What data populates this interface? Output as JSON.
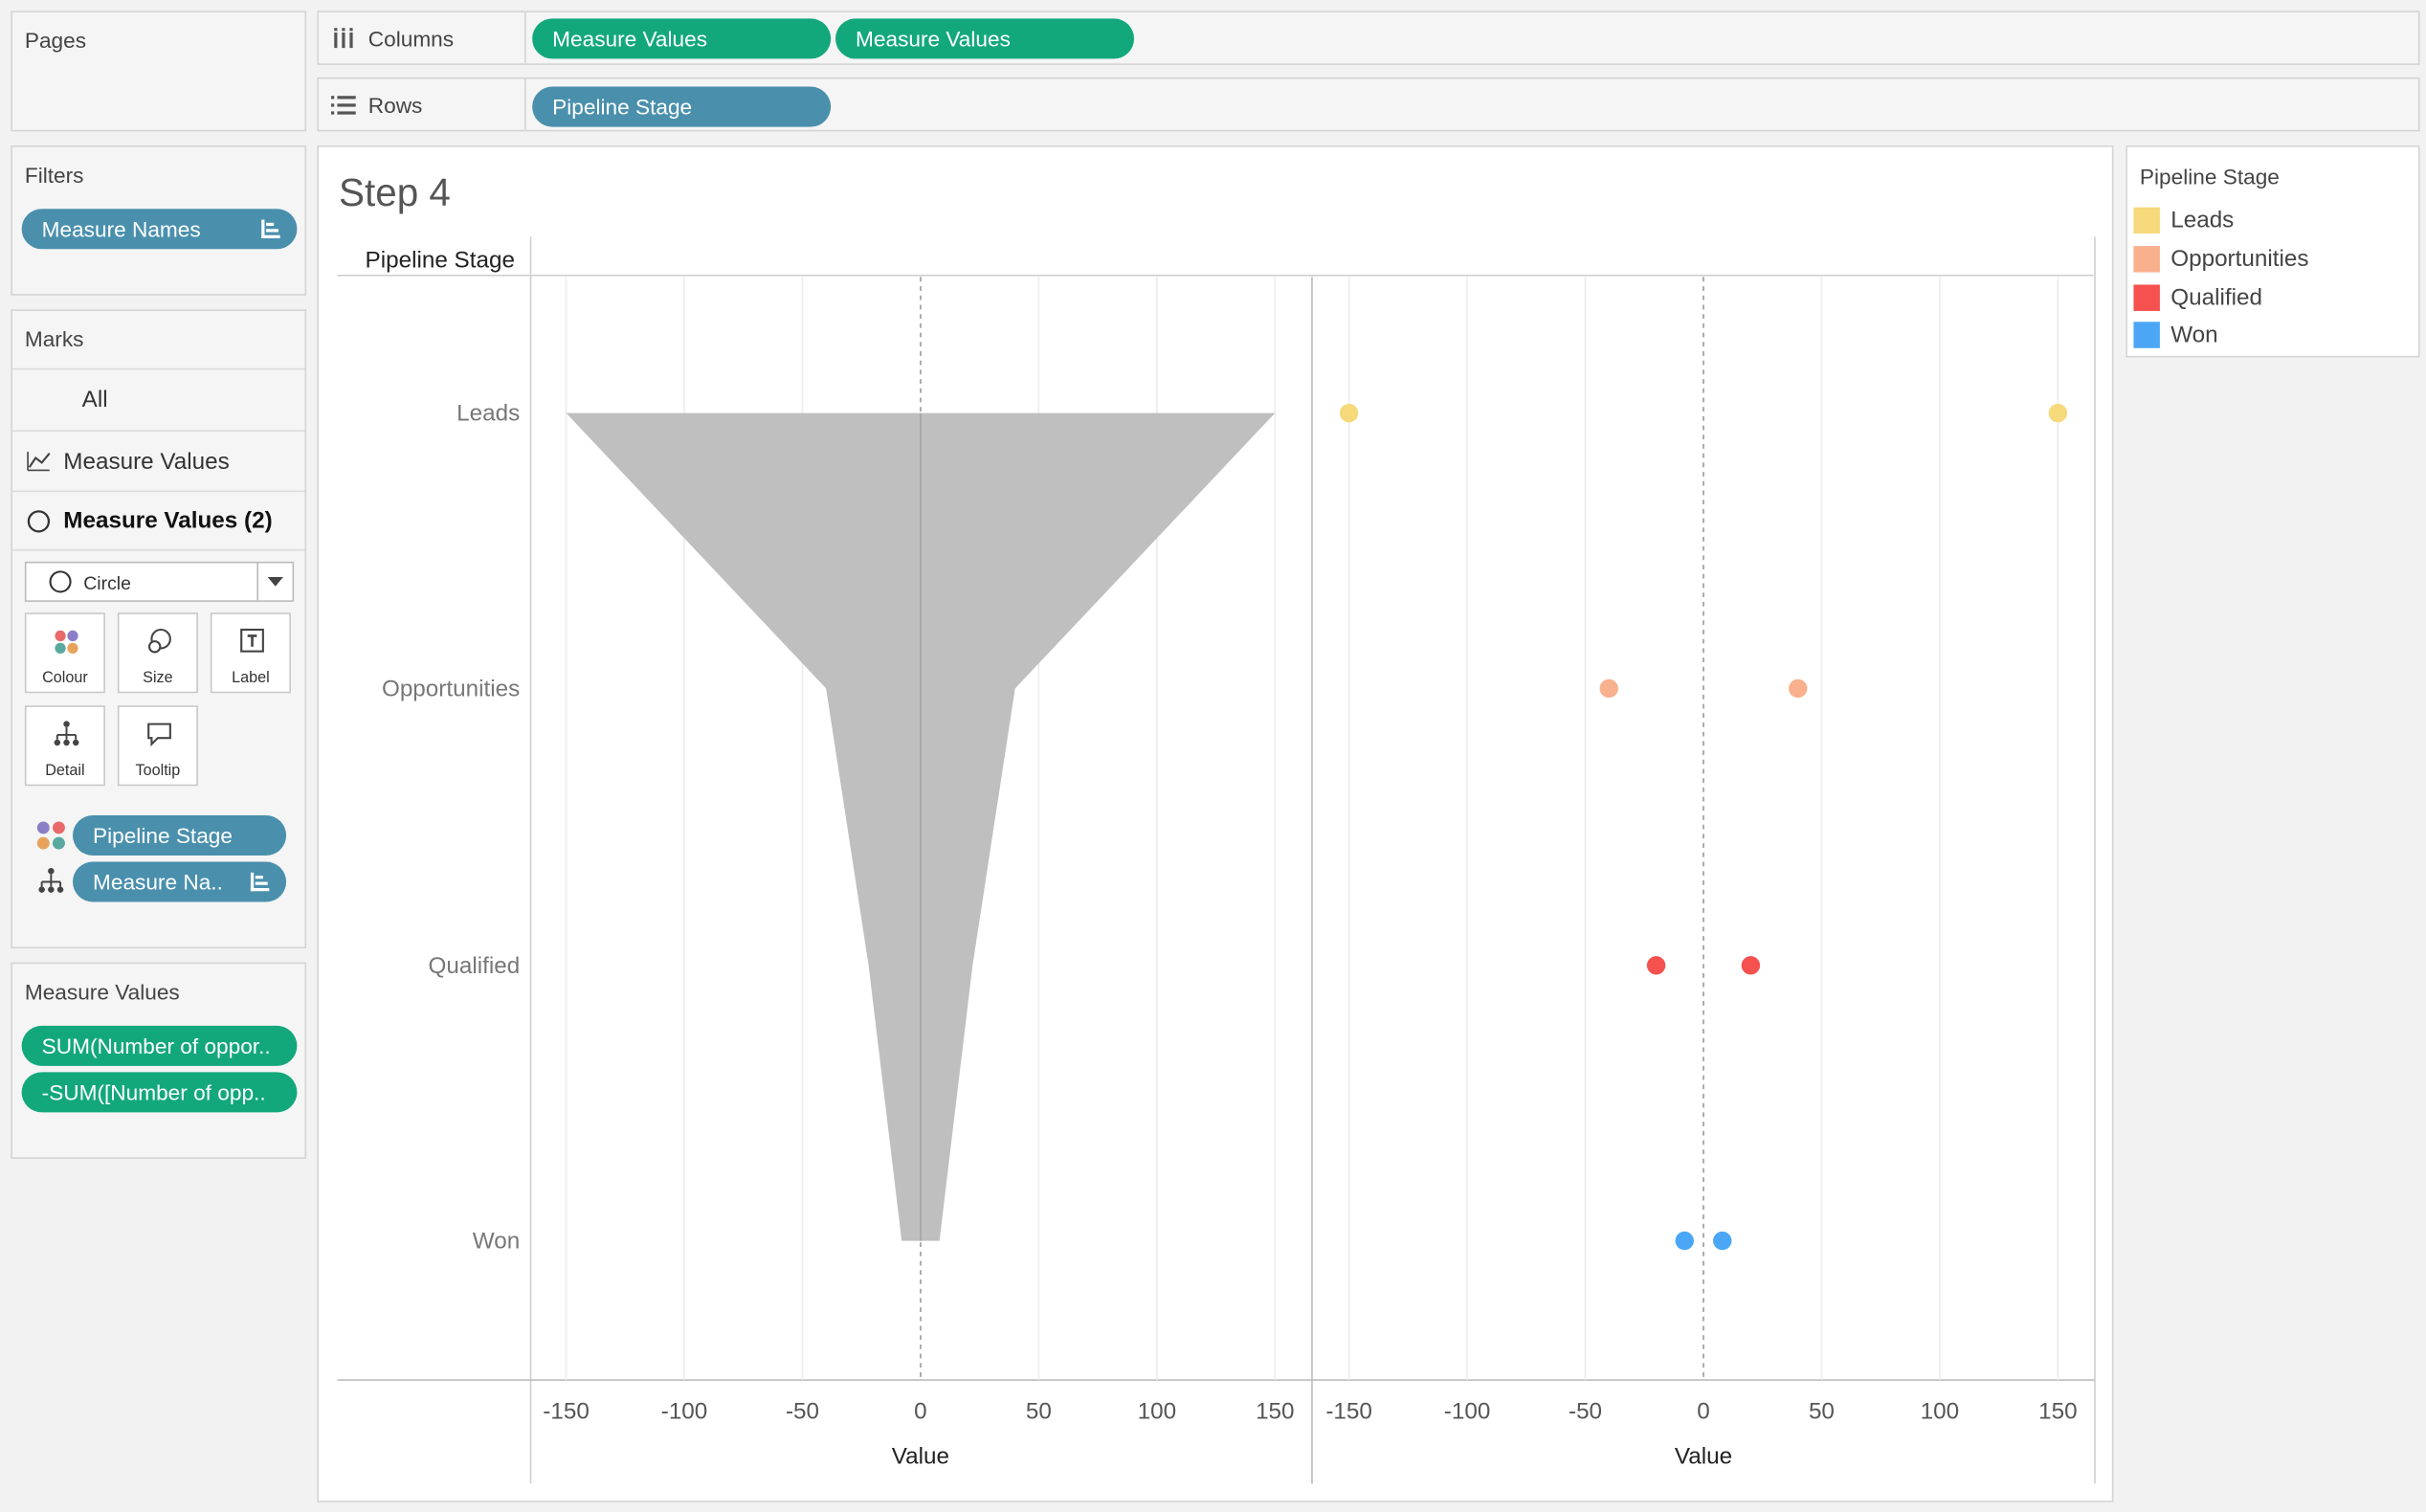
{
  "pages": {
    "title": "Pages"
  },
  "columns_shelf": {
    "label": "Columns",
    "pills": [
      "Measure Values",
      "Measure Values"
    ]
  },
  "rows_shelf": {
    "label": "Rows",
    "pills": [
      "Pipeline Stage"
    ]
  },
  "filters": {
    "title": "Filters",
    "pills": [
      "Measure Names"
    ]
  },
  "marks": {
    "title": "Marks",
    "rows": [
      "All",
      "Measure Values",
      "Measure Values (2)"
    ],
    "mark_type": "Circle",
    "buttons": [
      "Colour",
      "Size",
      "Label",
      "Detail",
      "Tooltip"
    ],
    "encodings": [
      "Pipeline Stage",
      "Measure Na.."
    ]
  },
  "measure_values": {
    "title": "Measure Values",
    "pills": [
      "SUM(Number of oppor..",
      "-SUM([Number of opp.."
    ]
  },
  "sheet": {
    "title": "Step 4",
    "row_header": "Pipeline Stage"
  },
  "legend": {
    "title": "Pipeline Stage",
    "items": [
      {
        "label": "Leads",
        "color": "#f5d97a"
      },
      {
        "label": "Opportunities",
        "color": "#f8b08d"
      },
      {
        "label": "Qualified",
        "color": "#f5514f"
      },
      {
        "label": "Won",
        "color": "#4ba7f5"
      }
    ]
  },
  "chart_data": [
    {
      "type": "area",
      "categories": [
        "Leads",
        "Opportunities",
        "Qualified",
        "Won"
      ],
      "series": [
        {
          "values": [
            150,
            40,
            22,
            8
          ]
        },
        {
          "values": [
            -150,
            -40,
            -22,
            -8
          ]
        }
      ],
      "xlabel": "Value",
      "xticks": [
        -150,
        -100,
        -50,
        0,
        50,
        100,
        150
      ],
      "xlim": [
        -165,
        165
      ],
      "fill_color": "#bfbfbf"
    },
    {
      "type": "scatter",
      "categories": [
        "Leads",
        "Opportunities",
        "Qualified",
        "Won"
      ],
      "series": [
        {
          "values": [
            150,
            40,
            20,
            8
          ]
        },
        {
          "values": [
            -150,
            -40,
            -20,
            -8
          ]
        }
      ],
      "xlabel": "Value",
      "xticks": [
        -150,
        -100,
        -50,
        0,
        50,
        100,
        150
      ],
      "xlim": [
        -165,
        165
      ]
    }
  ]
}
